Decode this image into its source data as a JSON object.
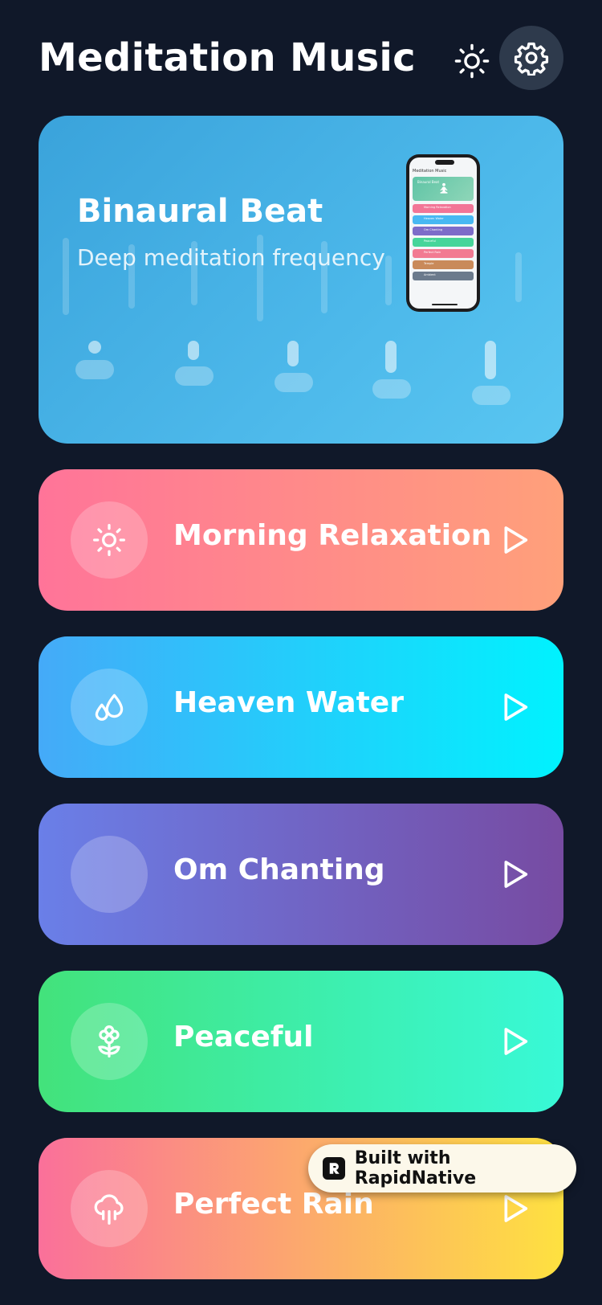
{
  "header": {
    "title": "Meditation Music",
    "theme_toggle_icon": "sun-icon",
    "settings_icon": "gear-icon"
  },
  "hero": {
    "title": "Binaural Beat",
    "subtitle": "Deep meditation frequency",
    "gradient": [
      "#3aa3db",
      "#59c6f1"
    ]
  },
  "phone_preview": {
    "title": "Meditation Music",
    "hero_label": "Binaural Beat",
    "rows": [
      {
        "label": "Morning Relaxation",
        "color": "#f27597"
      },
      {
        "label": "Heaven Water",
        "color": "#48b8f2"
      },
      {
        "label": "Om Chanting",
        "color": "#7d6cc9"
      },
      {
        "label": "Peaceful",
        "color": "#46d59a"
      },
      {
        "label": "Perfect Rain",
        "color": "#f27a92"
      },
      {
        "label": "Temple",
        "color": "#c98a5a"
      },
      {
        "label": "Ambient",
        "color": "#6b7a8c"
      }
    ]
  },
  "tracks": [
    {
      "label": "Morning Relaxation",
      "icon": "sun-icon",
      "gradient": [
        "#ff7499",
        "#ffa07a"
      ]
    },
    {
      "label": "Heaven Water",
      "icon": "water-drops-icon",
      "gradient": [
        "#45aaf8",
        "#00f2fe"
      ]
    },
    {
      "label": "Om Chanting",
      "icon": "",
      "gradient": [
        "#6a7fe8",
        "#774ba2"
      ]
    },
    {
      "label": "Peaceful",
      "icon": "flower-icon",
      "gradient": [
        "#43e27b",
        "#38f9d7"
      ]
    },
    {
      "label": "Perfect Rain",
      "icon": "cloud-rain-icon",
      "gradient": [
        "#fa709a",
        "#fee140"
      ]
    }
  ],
  "badge": {
    "text": "Built with RapidNative",
    "logo_letter": "R"
  }
}
